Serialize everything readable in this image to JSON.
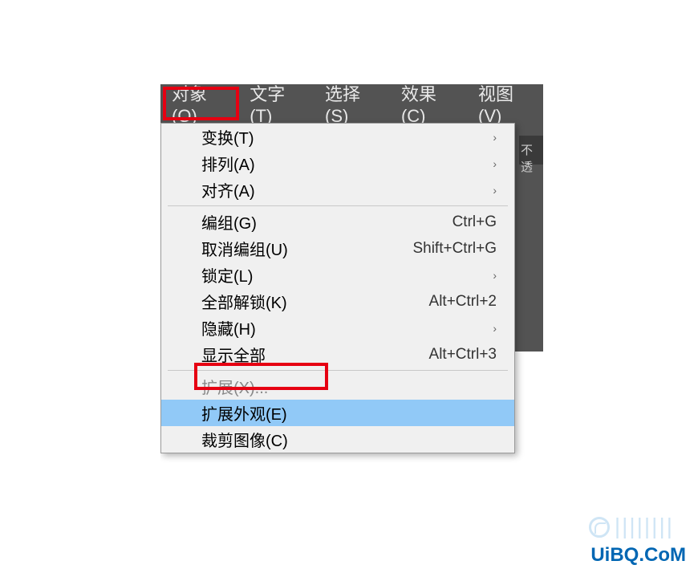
{
  "menubar": {
    "items": [
      {
        "label": "对象(O)"
      },
      {
        "label": "文字(T)"
      },
      {
        "label": "选择(S)"
      },
      {
        "label": "效果(C)"
      },
      {
        "label": "视图(V)"
      }
    ]
  },
  "panel": {
    "partial_text": "不透"
  },
  "dropdown": {
    "items": [
      {
        "label": "变换(T)",
        "shortcut": "",
        "has_submenu": true,
        "disabled": false,
        "highlighted": false
      },
      {
        "label": "排列(A)",
        "shortcut": "",
        "has_submenu": true,
        "disabled": false,
        "highlighted": false
      },
      {
        "label": "对齐(A)",
        "shortcut": "",
        "has_submenu": true,
        "disabled": false,
        "highlighted": false
      },
      {
        "type": "separator"
      },
      {
        "label": "编组(G)",
        "shortcut": "Ctrl+G",
        "has_submenu": false,
        "disabled": false,
        "highlighted": false
      },
      {
        "label": "取消编组(U)",
        "shortcut": "Shift+Ctrl+G",
        "has_submenu": false,
        "disabled": false,
        "highlighted": false
      },
      {
        "label": "锁定(L)",
        "shortcut": "",
        "has_submenu": true,
        "disabled": false,
        "highlighted": false
      },
      {
        "label": "全部解锁(K)",
        "shortcut": "Alt+Ctrl+2",
        "has_submenu": false,
        "disabled": false,
        "highlighted": false
      },
      {
        "label": "隐藏(H)",
        "shortcut": "",
        "has_submenu": true,
        "disabled": false,
        "highlighted": false
      },
      {
        "label": "显示全部",
        "shortcut": "Alt+Ctrl+3",
        "has_submenu": false,
        "disabled": false,
        "highlighted": false
      },
      {
        "type": "separator"
      },
      {
        "label": "扩展(X)...",
        "shortcut": "",
        "has_submenu": false,
        "disabled": true,
        "highlighted": false
      },
      {
        "label": "扩展外观(E)",
        "shortcut": "",
        "has_submenu": false,
        "disabled": false,
        "highlighted": true
      },
      {
        "label": "裁剪图像(C)",
        "shortcut": "",
        "has_submenu": false,
        "disabled": false,
        "highlighted": false
      }
    ]
  },
  "watermark": {
    "text": "UiBQ.CoM"
  }
}
